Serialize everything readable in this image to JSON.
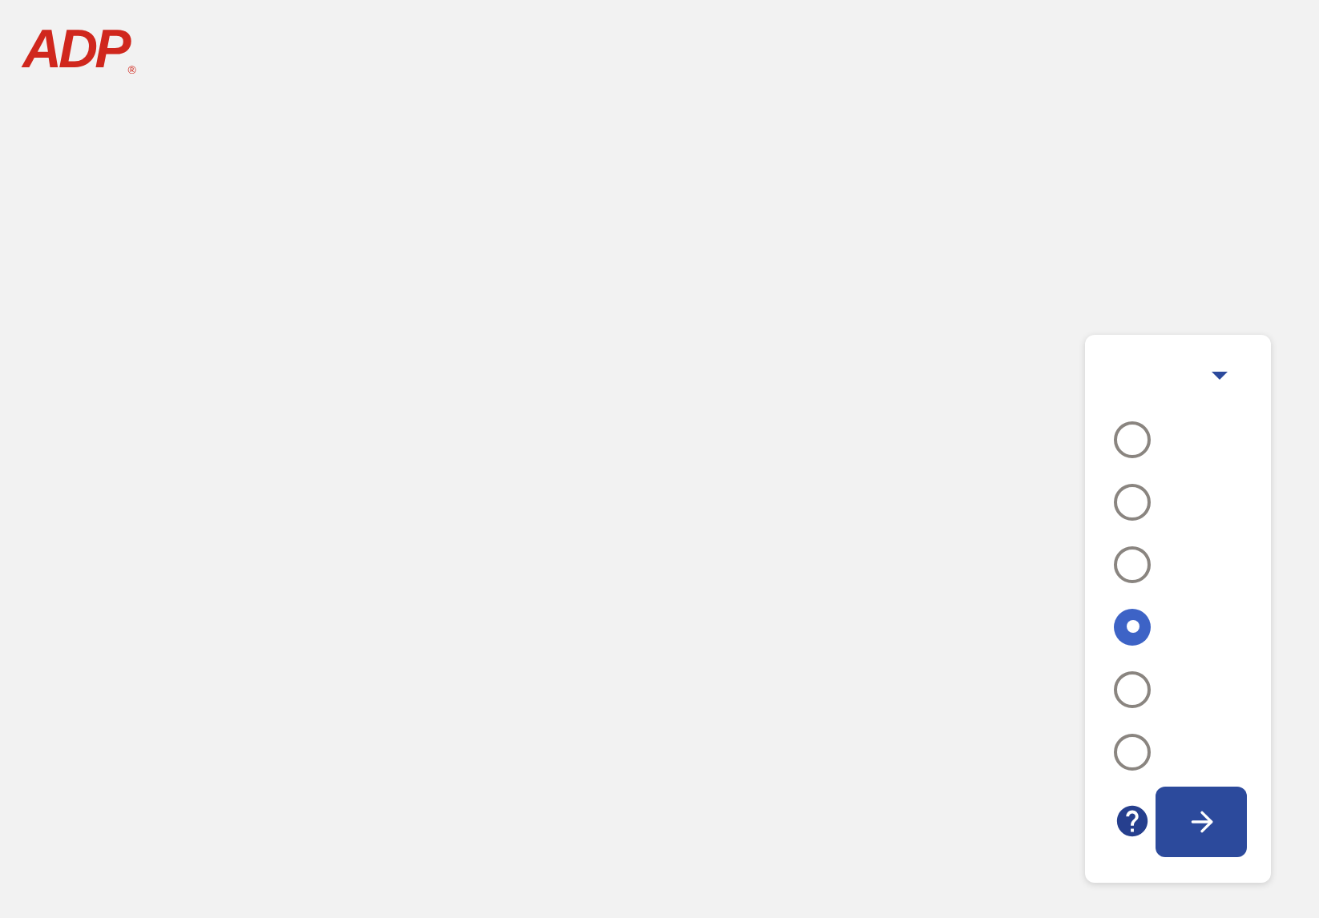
{
  "logo": {
    "text": "ADP",
    "mark": "®"
  },
  "options": [
    {
      "selected": false
    },
    {
      "selected": false
    },
    {
      "selected": false
    },
    {
      "selected": true
    },
    {
      "selected": false
    },
    {
      "selected": false
    }
  ]
}
